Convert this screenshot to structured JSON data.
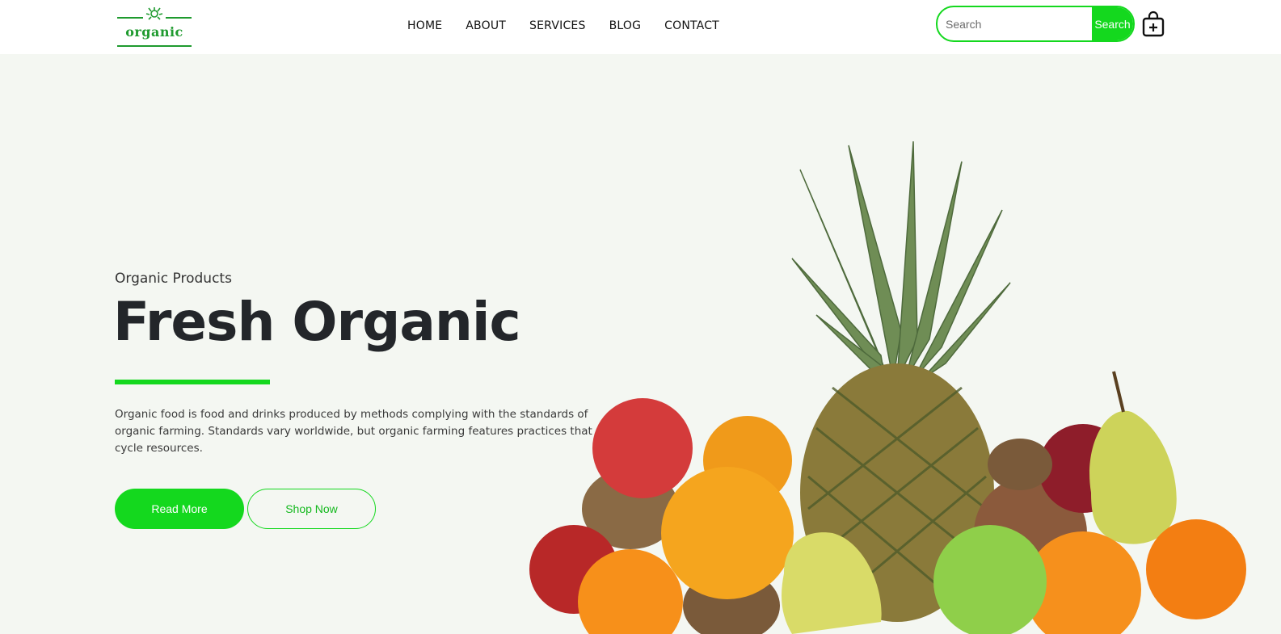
{
  "brand": {
    "logo_text": "organic",
    "accent": "#14d81e",
    "logo_color": "#1e9a2e"
  },
  "nav": {
    "items": [
      "HOME",
      "ABOUT",
      "SERVICES",
      "BLOG",
      "CONTACT"
    ]
  },
  "search": {
    "placeholder": "Search",
    "button_label": "Search"
  },
  "cart": {
    "icon": "shopping-bag-plus-icon"
  },
  "hero": {
    "subtitle": "Organic Products",
    "title": "Fresh Organic",
    "description": "Organic food is food and drinks produced by methods complying with the standards of organic farming. Standards vary worldwide, but organic farming features practices that cycle resources.",
    "read_more_label": "Read More",
    "shop_now_label": "Shop Now"
  },
  "hero_image": {
    "subject": "fruits"
  }
}
